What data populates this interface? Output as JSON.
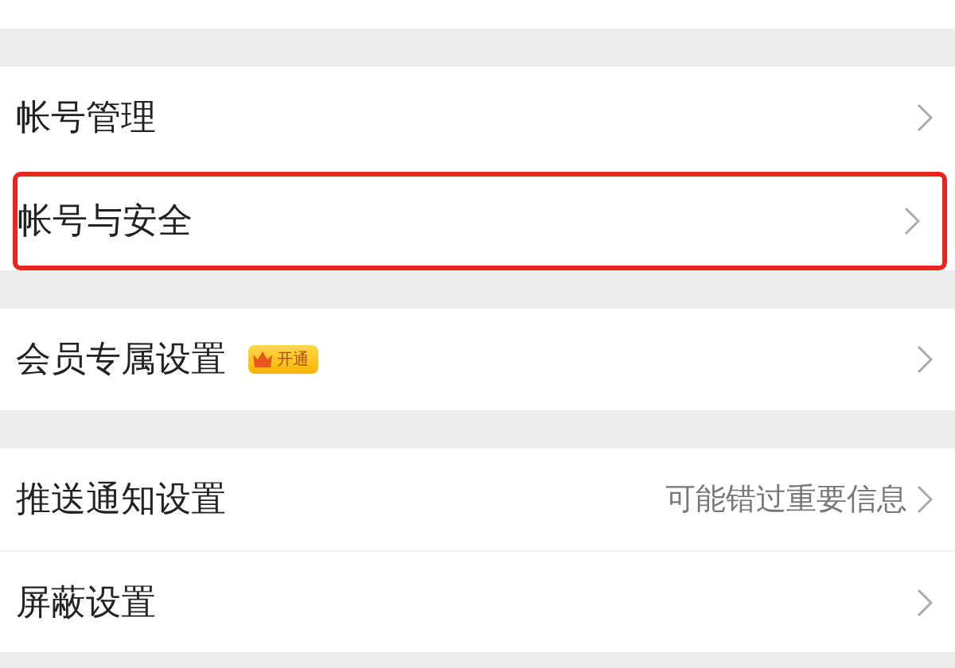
{
  "groups": [
    {
      "rows": [
        {
          "label": "帐号管理",
          "highlighted": false
        },
        {
          "label": "帐号与安全",
          "highlighted": true
        }
      ]
    },
    {
      "rows": [
        {
          "label": "会员专属设置",
          "highlighted": false,
          "badge": "开通"
        }
      ]
    },
    {
      "rows": [
        {
          "label": "推送通知设置",
          "highlighted": false,
          "hint": "可能错过重要信息"
        },
        {
          "label": "屏蔽设置",
          "highlighted": false
        }
      ]
    }
  ]
}
